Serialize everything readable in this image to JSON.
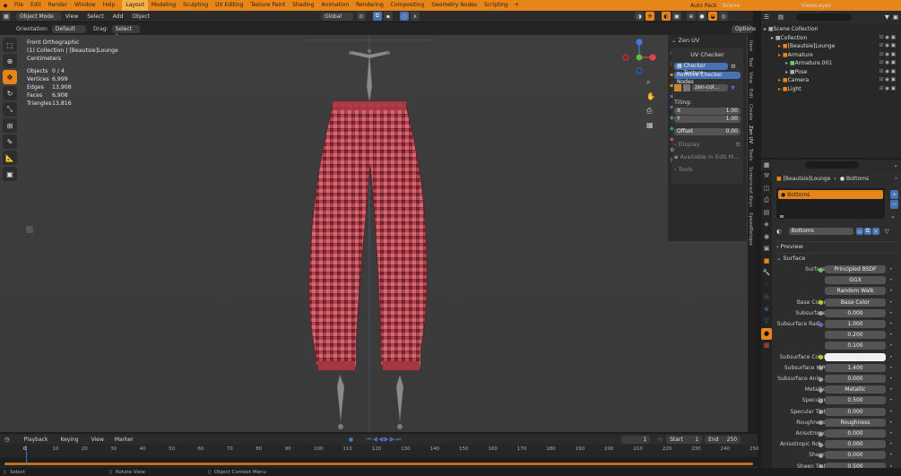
{
  "topbar": {
    "menus": [
      "File",
      "Edit",
      "Render",
      "Window",
      "Help"
    ],
    "workspaces": [
      "Layout",
      "Modeling",
      "Sculpting",
      "UV Editing",
      "Texture Paint",
      "Shading",
      "Animation",
      "Rendering",
      "Compositing",
      "Geometry Nodes",
      "Scripting"
    ],
    "active_workspace": "Layout",
    "autopack": "Auto Pack",
    "scene": "Scene",
    "view_layer": "ViewLayer"
  },
  "viewport_header": {
    "mode": "Object Mode",
    "menus": [
      "View",
      "Select",
      "Add",
      "Object"
    ],
    "transform": "Global",
    "orientation_label": "Orientation:",
    "orientation": "Default",
    "drag_label": "Drag:",
    "drag": "Select Box",
    "options": "Options"
  },
  "overlay": {
    "view": "Front Orthographic",
    "collection": "(1) Collection | [Beautsie]Lounge",
    "units": "Centimeters",
    "stats": [
      {
        "k": "Objects",
        "v": "0 / 4"
      },
      {
        "k": "Vertices",
        "v": "6,999"
      },
      {
        "k": "Edges",
        "v": "13,908"
      },
      {
        "k": "Faces",
        "v": "6,908"
      },
      {
        "k": "Triangles",
        "v": "13,816"
      }
    ]
  },
  "npanel": {
    "title": "Zen UV",
    "uv_checker": "UV Checker",
    "checker_texture": "Checker Texture",
    "remove_nodes": "Remove Checker Nodes",
    "texture_name": "zen-col...",
    "tiling": "Tiling:",
    "x_label": "X",
    "x_value": "1.00",
    "y_label": "Y",
    "y_value": "1.00",
    "offset_label": "Offset",
    "offset_value": "0.00",
    "display": "Display",
    "available": "Available in Edit M...",
    "tools": "Tools",
    "tabs": [
      "Item",
      "Tool",
      "View",
      "Edit",
      "Create",
      "Zen UV",
      "Tools",
      "Screencast Keys",
      "SpeedRetopo"
    ]
  },
  "outliner": {
    "items": [
      {
        "label": "Scene Collection",
        "depth": 0,
        "color": "#b0b0b0"
      },
      {
        "label": "Collection",
        "depth": 1,
        "color": "#b0b0b0"
      },
      {
        "label": "[Beautsie]Lounge",
        "depth": 2,
        "color": "#e6861a"
      },
      {
        "label": "Armature",
        "depth": 2,
        "color": "#e6861a"
      },
      {
        "label": "Armature.001",
        "depth": 3,
        "color": "#6ec86e"
      },
      {
        "label": "Pose",
        "depth": 3,
        "color": "#b0b0b0"
      },
      {
        "label": "Camera",
        "depth": 2,
        "color": "#e6861a"
      },
      {
        "label": "Light",
        "depth": 2,
        "color": "#e6861a"
      }
    ]
  },
  "properties": {
    "breadcrumb_object": "[Beautsie]Lounge",
    "breadcrumb_material": "Bottoms",
    "slot": "Bottoms",
    "material_name": "Bottoms",
    "preview": "Preview",
    "surface_panel": "Surface",
    "rows": [
      {
        "label": "Surface",
        "value": "Principled BSDF",
        "sock": "#63c763"
      },
      {
        "label": "",
        "value": "GGX",
        "sock": ""
      },
      {
        "label": "",
        "value": "Random Walk",
        "sock": ""
      },
      {
        "label": "Base Color",
        "value": "Base Color",
        "sock": "#c7c729"
      },
      {
        "label": "Subsurface",
        "value": "0.000",
        "sock": "#a1a1a1"
      },
      {
        "label": "Subsurface Radi...",
        "value": "1.000",
        "sock": "#6363c7"
      },
      {
        "label": "",
        "value": "0.200",
        "sock": ""
      },
      {
        "label": "",
        "value": "0.100",
        "sock": ""
      },
      {
        "label": "Subsurface Color",
        "value": "",
        "sock": "#c7c729"
      },
      {
        "label": "Subsurface IOR",
        "value": "1.400",
        "sock": "#a1a1a1"
      },
      {
        "label": "Subsurface Anis...",
        "value": "0.000",
        "sock": "#a1a1a1"
      },
      {
        "label": "Metallic",
        "value": "Metallic",
        "sock": "#a1a1a1"
      },
      {
        "label": "Specular",
        "value": "0.500",
        "sock": "#a1a1a1"
      },
      {
        "label": "Specular Tint",
        "value": "0.000",
        "sock": "#a1a1a1"
      },
      {
        "label": "Roughness",
        "value": "Roughness",
        "sock": "#a1a1a1"
      },
      {
        "label": "Anisotropic",
        "value": "0.000",
        "sock": "#a1a1a1"
      },
      {
        "label": "Anisotropic Rot...",
        "value": "0.000",
        "sock": "#a1a1a1"
      },
      {
        "label": "Sheen",
        "value": "0.000",
        "sock": "#a1a1a1"
      },
      {
        "label": "Sheen Tint",
        "value": "0.500",
        "sock": "#a1a1a1"
      }
    ]
  },
  "timeline": {
    "menus": [
      "Playback",
      "Keying",
      "View",
      "Marker"
    ],
    "current_frame": "1",
    "start_label": "Start",
    "start": "1",
    "end_label": "End",
    "end": "250",
    "ticks": [
      "0",
      "10",
      "20",
      "30",
      "40",
      "50",
      "60",
      "70",
      "80",
      "90",
      "100",
      "110",
      "120",
      "130",
      "140",
      "150",
      "160",
      "170",
      "180",
      "190",
      "200",
      "210",
      "220",
      "230",
      "240",
      "250"
    ]
  },
  "status": {
    "items": [
      "Select",
      "Rotate View",
      "Object Context Menu"
    ]
  },
  "colors": {
    "accent": "#e6861a",
    "selection_blue": "#4772b3",
    "fabric": "#b8404b"
  }
}
